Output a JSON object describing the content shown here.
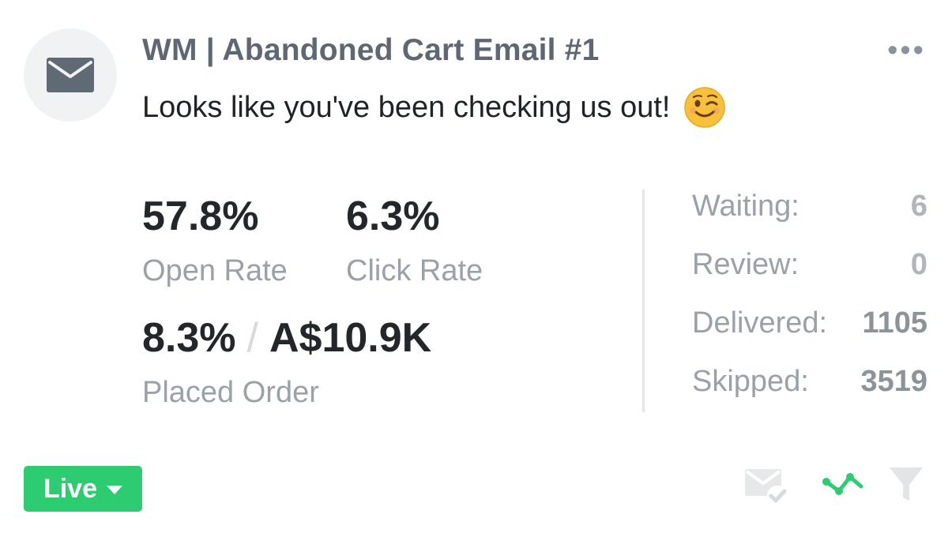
{
  "header": {
    "title": "WM | Abandoned Cart Email #1",
    "subject": "Looks like you've been checking us out!",
    "subject_emoji": "wink-emoji",
    "more_menu": "•••",
    "avatar_icon": "envelope-icon"
  },
  "stats": {
    "open_rate": {
      "value": "57.8%",
      "label": "Open Rate"
    },
    "click_rate": {
      "value": "6.3%",
      "label": "Click Rate"
    },
    "placed_order": {
      "rate": "8.3%",
      "separator": "/",
      "revenue": "A$10.9K",
      "label": "Placed Order"
    }
  },
  "counts": [
    {
      "label": "Waiting:",
      "value": "6"
    },
    {
      "label": "Review:",
      "value": "0"
    },
    {
      "label": "Delivered:",
      "value": "1105"
    },
    {
      "label": "Skipped:",
      "value": "3519"
    }
  ],
  "status": {
    "label": "Live",
    "color": "#2ecc71"
  },
  "toolbar": {
    "icons": [
      "email-check-icon",
      "trend-line-icon",
      "filter-icon"
    ],
    "accent_color": "#2ecc71"
  }
}
